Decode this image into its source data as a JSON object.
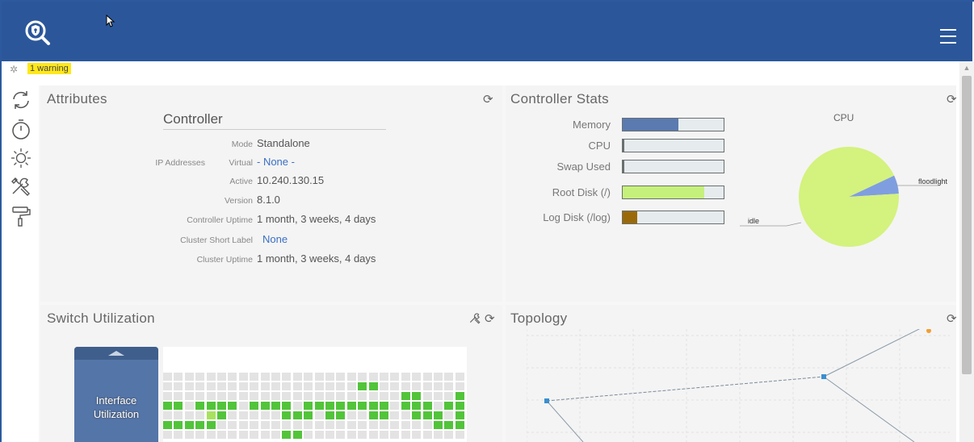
{
  "header": {
    "menu_icon": "hamburger-menu-icon",
    "logo_icon": "shield-search-logo-icon"
  },
  "warning": {
    "text": "1 warning"
  },
  "toolbar": {
    "tools": [
      "refresh-icon",
      "timer-icon",
      "sun-icon",
      "tools-icon",
      "paint-roller-icon"
    ]
  },
  "attributes": {
    "title": "Attributes",
    "controller_heading": "Controller",
    "rows": [
      {
        "label": "Mode",
        "value": "Standalone"
      },
      {
        "label": "IP Addresses",
        "sublabel": "Virtual",
        "value": "- None -"
      },
      {
        "label": "",
        "sublabel": "Active",
        "value": "10.240.130.15"
      },
      {
        "label": "Version",
        "value": "8.1.0"
      },
      {
        "label": "Controller Uptime",
        "value": "1 month, 3 weeks, 4 days"
      },
      {
        "label": "Cluster Short Label",
        "value": "None"
      },
      {
        "label": "Cluster Uptime",
        "value": "1 month, 3 weeks, 4 days"
      }
    ]
  },
  "controller_stats": {
    "title": "Controller Stats",
    "stats": [
      {
        "label": "Memory",
        "fraction": 0.55,
        "color": "#5a7ab0"
      },
      {
        "label": "CPU",
        "fraction": 0.01,
        "color": "#6a7070"
      },
      {
        "label": "Swap Used",
        "fraction": 0.01,
        "color": "#6a7070"
      },
      {
        "label": "Root Disk (/)",
        "fraction": 0.81,
        "color": "#c6f07c"
      },
      {
        "label": "Log Disk (/log)",
        "fraction": 0.14,
        "color": "#9a6a0a"
      }
    ],
    "cpu_title": "CPU",
    "chart_data": {
      "type": "pie",
      "title": "CPU",
      "labels": [
        "idle",
        "floodlight"
      ],
      "values": [
        0.94,
        0.06
      ],
      "colors": [
        "#d4f27e",
        "#7f9ee0"
      ]
    }
  },
  "switch_utilization": {
    "title": "Switch Utilization",
    "card_label": "Interface Utilization",
    "grid_rows": [
      "0000000000000000000000000000",
      "0000000000000000001100000000",
      "0000000000000000000000110001",
      "1101111011110111111110111011",
      "0000320000011101100110011101",
      "1111100000000000000000000111",
      "0000000000011000000000000000"
    ],
    "colors": {
      "empty": "#e3e3e3",
      "high": "#52c43a",
      "mid": "#a8e060"
    }
  },
  "topology": {
    "title": "Topology",
    "nodes": [
      {
        "color": "#3a8fd0"
      },
      {
        "color": "#3a8fd0"
      },
      {
        "color": "#f0a030"
      }
    ]
  }
}
